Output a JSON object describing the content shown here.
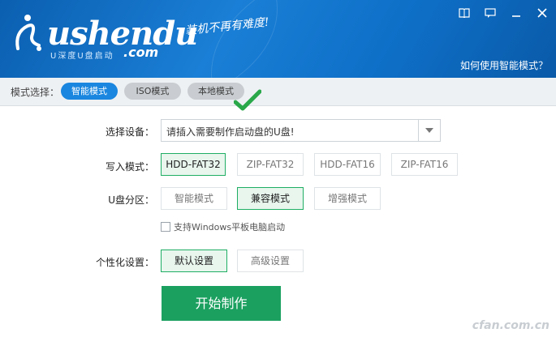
{
  "header": {
    "logo_text": "ushendu",
    "logo_sub": "U深度U盘启动",
    "logo_dotcom": ".com",
    "slogan": "装机不再有难度!",
    "help_link": "如何使用智能模式？"
  },
  "window_controls": [
    "book-icon",
    "chat-icon",
    "minimize-icon",
    "close-icon"
  ],
  "mode_bar": {
    "label": "模式选择：",
    "tabs": [
      {
        "label": "智能模式",
        "active": true
      },
      {
        "label": "ISO模式",
        "active": false
      },
      {
        "label": "本地模式",
        "active": false
      }
    ]
  },
  "form": {
    "device": {
      "label": "选择设备：",
      "value": "请插入需要制作启动盘的U盘!"
    },
    "write_mode": {
      "label": "写入模式：",
      "options": [
        "HDD-FAT32",
        "ZIP-FAT32",
        "HDD-FAT16",
        "ZIP-FAT16"
      ],
      "selected": "HDD-FAT32"
    },
    "partition": {
      "label": "U盘分区：",
      "options": [
        "智能模式",
        "兼容模式",
        "增强模式"
      ],
      "selected": "兼容模式"
    },
    "windows_tablet": {
      "label": "支持Windows平板电脑启动",
      "checked": false
    },
    "personalize": {
      "label": "个性化设置：",
      "options": [
        "默认设置",
        "高级设置"
      ],
      "selected": "默认设置"
    },
    "start_button": "开始制作"
  },
  "watermark": "cfan.com.cn",
  "colors": {
    "accent_blue": "#1a86df",
    "header_blue": "#0e6fc7",
    "green": "#1ba060"
  }
}
